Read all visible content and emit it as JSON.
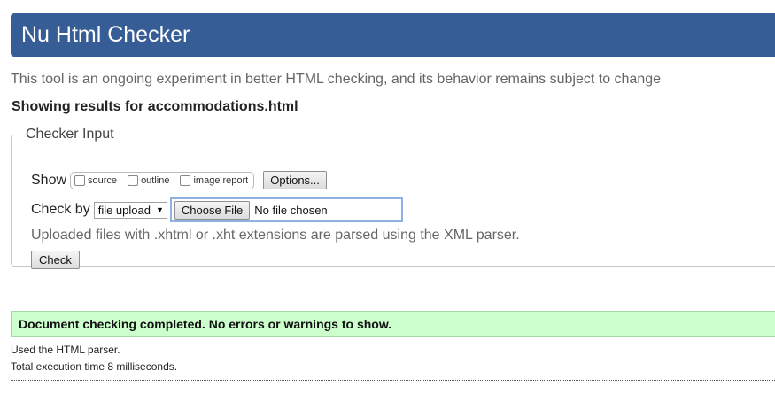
{
  "header": {
    "title": "Nu Html Checker"
  },
  "intro": "This tool is an ongoing experiment in better HTML checking, and its behavior remains subject to change",
  "showing_results": "Showing results for accommodations.html",
  "checker_input": {
    "legend": "Checker Input",
    "show_label": "Show",
    "show_options": [
      {
        "label": "source",
        "checked": false
      },
      {
        "label": "outline",
        "checked": false
      },
      {
        "label": "image report",
        "checked": false
      }
    ],
    "options_button": "Options...",
    "check_by_label": "Check by",
    "check_by_selected": "file upload",
    "choose_file_button": "Choose File",
    "file_status": "No file chosen",
    "note": "Uploaded files with .xhtml or .xht extensions are parsed using the XML parser.",
    "check_button": "Check"
  },
  "result": {
    "success_message": "Document checking completed. No errors or warnings to show.",
    "parser_line": "Used the HTML parser.",
    "time_line": "Total execution time 8 milliseconds."
  },
  "colors": {
    "header_bg": "#365d95",
    "success_bg": "#ccffcc"
  }
}
